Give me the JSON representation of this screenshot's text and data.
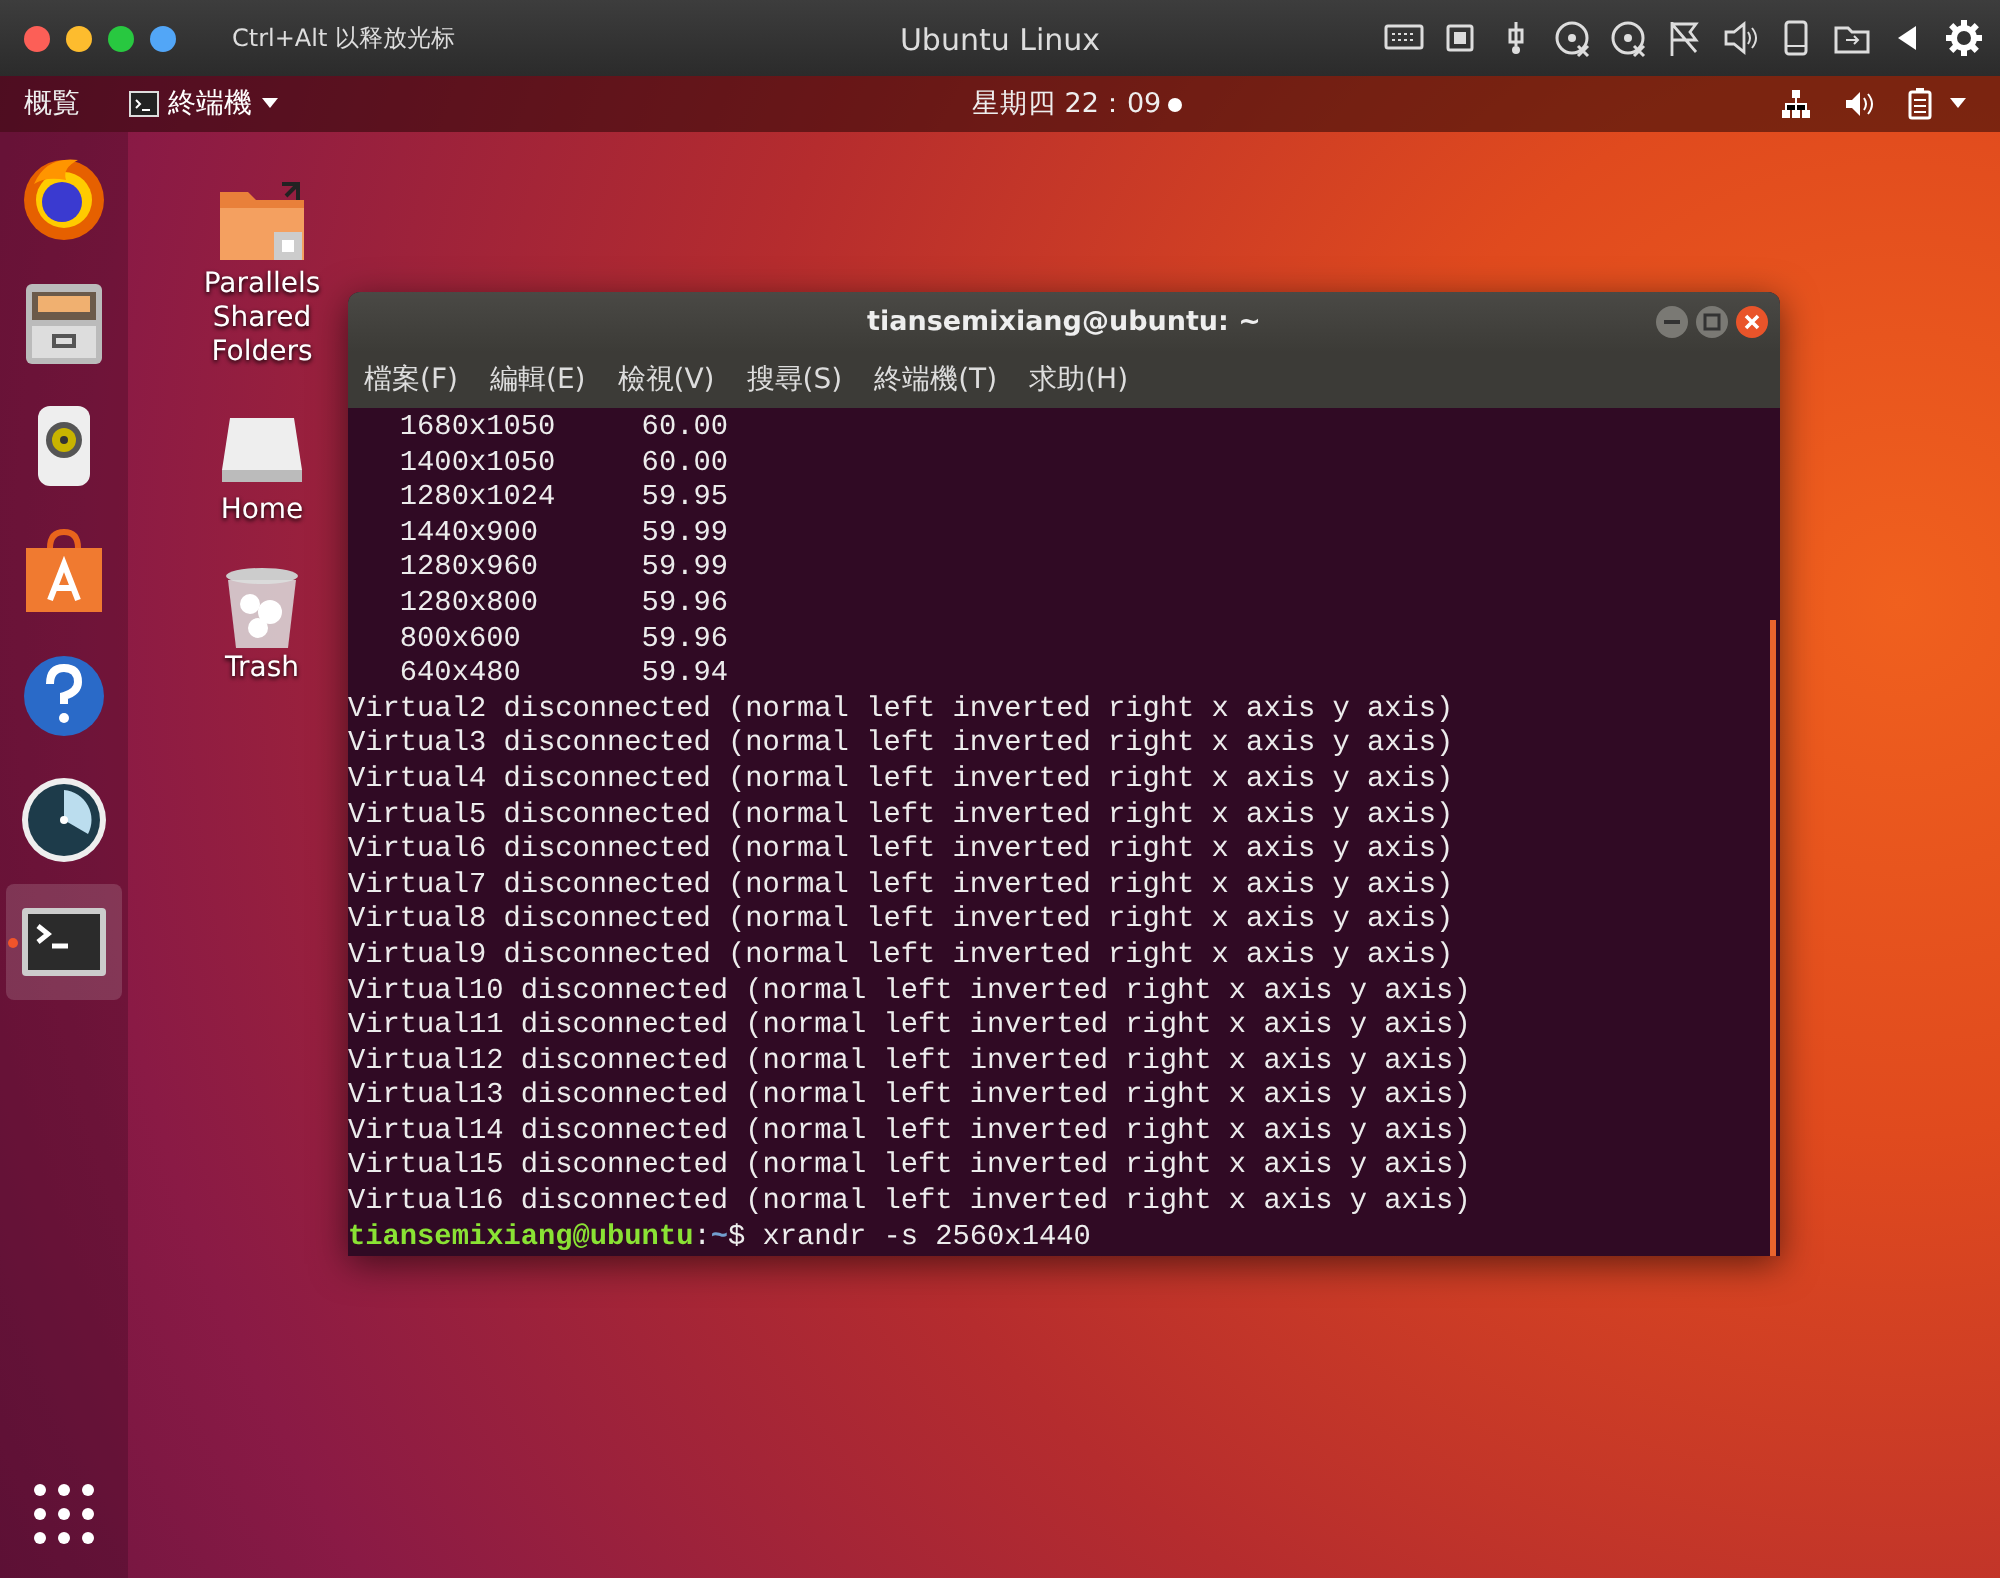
{
  "host_window": {
    "title": "Ubuntu Linux",
    "hint": "Ctrl+Alt 以释放光标"
  },
  "top_bar": {
    "activities": "概覧",
    "app_menu": "終端機",
    "clock": "星期四 22：09",
    "notification_dot": true
  },
  "dock": {
    "items": [
      {
        "kind": "firefox",
        "running": false,
        "selected": false
      },
      {
        "kind": "files",
        "running": false,
        "selected": false
      },
      {
        "kind": "music",
        "running": false,
        "selected": false
      },
      {
        "kind": "software",
        "running": false,
        "selected": false
      },
      {
        "kind": "help",
        "running": false,
        "selected": false
      },
      {
        "kind": "stacer",
        "running": false,
        "selected": false
      },
      {
        "kind": "terminal",
        "running": true,
        "selected": true
      }
    ]
  },
  "desktop_icons": [
    {
      "kind": "shared-folder",
      "label": "Parallels Shared Folders"
    },
    {
      "kind": "drive",
      "label": "Home"
    },
    {
      "kind": "trash",
      "label": "Trash"
    }
  ],
  "terminal": {
    "title": "tiansemixiang@ubuntu: ~",
    "menu": [
      "檔案(F)",
      "編輯(E)",
      "檢視(V)",
      "搜尋(S)",
      "終端機(T)",
      "求助(H)"
    ],
    "lines": [
      {
        "kind": "output",
        "text": "   1680x1050     60.00"
      },
      {
        "kind": "output",
        "text": "   1400x1050     60.00"
      },
      {
        "kind": "output",
        "text": "   1280x1024     59.95"
      },
      {
        "kind": "output",
        "text": "   1440x900      59.99"
      },
      {
        "kind": "output",
        "text": "   1280x960      59.99"
      },
      {
        "kind": "output",
        "text": "   1280x800      59.96"
      },
      {
        "kind": "output",
        "text": "   800x600       59.96"
      },
      {
        "kind": "output",
        "text": "   640x480       59.94"
      },
      {
        "kind": "output",
        "text": "Virtual2 disconnected (normal left inverted right x axis y axis)"
      },
      {
        "kind": "output",
        "text": "Virtual3 disconnected (normal left inverted right x axis y axis)"
      },
      {
        "kind": "output",
        "text": "Virtual4 disconnected (normal left inverted right x axis y axis)"
      },
      {
        "kind": "output",
        "text": "Virtual5 disconnected (normal left inverted right x axis y axis)"
      },
      {
        "kind": "output",
        "text": "Virtual6 disconnected (normal left inverted right x axis y axis)"
      },
      {
        "kind": "output",
        "text": "Virtual7 disconnected (normal left inverted right x axis y axis)"
      },
      {
        "kind": "output",
        "text": "Virtual8 disconnected (normal left inverted right x axis y axis)"
      },
      {
        "kind": "output",
        "text": "Virtual9 disconnected (normal left inverted right x axis y axis)"
      },
      {
        "kind": "output",
        "text": "Virtual10 disconnected (normal left inverted right x axis y axis)"
      },
      {
        "kind": "output",
        "text": "Virtual11 disconnected (normal left inverted right x axis y axis)"
      },
      {
        "kind": "output",
        "text": "Virtual12 disconnected (normal left inverted right x axis y axis)"
      },
      {
        "kind": "output",
        "text": "Virtual13 disconnected (normal left inverted right x axis y axis)"
      },
      {
        "kind": "output",
        "text": "Virtual14 disconnected (normal left inverted right x axis y axis)"
      },
      {
        "kind": "output",
        "text": "Virtual15 disconnected (normal left inverted right x axis y axis)"
      },
      {
        "kind": "output",
        "text": "Virtual16 disconnected (normal left inverted right x axis y axis)"
      },
      {
        "kind": "prompt",
        "user": "tiansemixiang@ubuntu",
        "separator": ":",
        "path": "~",
        "symbol": "$",
        "command": "xrandr -s 2560x1440"
      }
    ]
  }
}
